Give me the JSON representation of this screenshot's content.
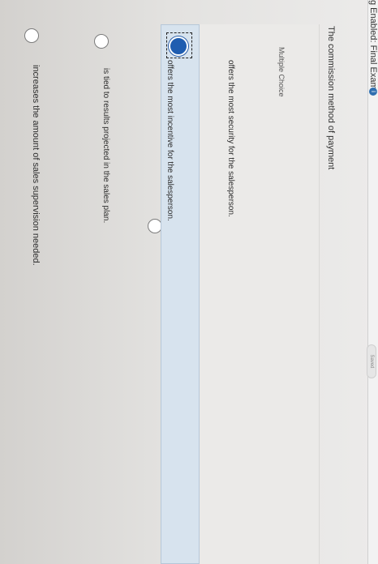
{
  "header": {
    "exam_title": "g Enabled: Final Exam",
    "info_badge": "i",
    "saved_label": "Saved"
  },
  "question": {
    "prompt": "The commission method of payment",
    "type_label": "Multiple Choice"
  },
  "options": [
    {
      "label": "offers the most security for the salesperson.",
      "selected": false
    },
    {
      "label": "offers the most incentive for the salesperson.",
      "selected": true
    },
    {
      "label": "is tied to results projected in the sales plan.",
      "selected": false
    },
    {
      "label": "increases the amount of sales supervision needed.",
      "selected": false
    }
  ]
}
